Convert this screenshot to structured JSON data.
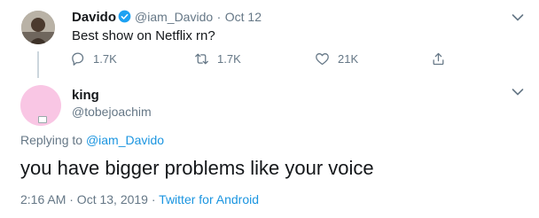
{
  "parent_tweet": {
    "name": "Davido",
    "handle": "@iam_Davido",
    "separator": "·",
    "date": "Oct 12",
    "text": "Best show on Netflix rn?",
    "reply_count": "1.7K",
    "retweet_count": "1.7K",
    "like_count": "21K"
  },
  "reply_tweet": {
    "name": "king",
    "handle": "@tobejoachim",
    "replying_to_label": "Replying to",
    "replying_to_handle": "@iam_Davido",
    "text": "you have bigger problems like your voice",
    "timestamp": "2:16 AM · Oct 13, 2019 · ",
    "client": "Twitter for Android"
  },
  "colors": {
    "accent": "#1b95e0",
    "muted": "#657786",
    "text": "#14171a",
    "verified": "#1da1f2"
  },
  "icons": [
    "chevron-down-icon",
    "verified-badge-icon",
    "reply-icon",
    "retweet-icon",
    "like-icon",
    "share-icon"
  ]
}
